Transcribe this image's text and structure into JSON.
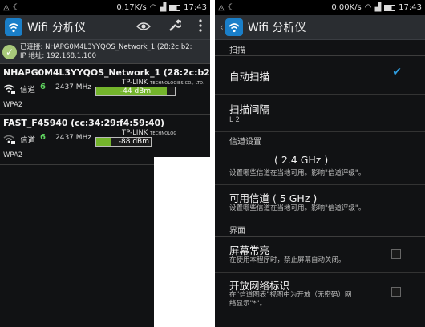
{
  "left": {
    "status": {
      "signal": "0.17K/s",
      "time": "17:43"
    },
    "app_title": "Wifi 分析仪",
    "connected": {
      "line1": "已连接: NHAPG0M4L3YYQOS_Network_1 (28:2c:b2:",
      "line2": "IP 地址: 192.168.1.100"
    },
    "networks": [
      {
        "ssid": "NHAPG0M4L3YYQOS_Network_1 (28:2c:b2:c.",
        "channel_label": "信道",
        "channel": "6",
        "freq": "2437 MHz",
        "vendor": "TP-LINK",
        "vendor_sub": "TECHNOLOGIES CO., LTD.",
        "dbm": "-44 dBm",
        "strength": 0.9,
        "security": "WPA2"
      },
      {
        "ssid": "FAST_F45940 (cc:34:29:f4:59:40)",
        "channel_label": "信道",
        "channel": "6",
        "freq": "2437 MHz",
        "vendor": "TP-LINK",
        "vendor_sub": "TECHNOLOG",
        "dbm": "-88 dBm",
        "strength": 0.28,
        "security": "WPA2"
      }
    ]
  },
  "right": {
    "status": {
      "signal": "0.00K/s",
      "time": "17:43"
    },
    "app_title": "Wifi 分析仪",
    "sections": {
      "scan": "扫描",
      "channel": "信道设置",
      "ui": "界面"
    },
    "prefs": {
      "auto_scan": {
        "title": "自动扫描",
        "checked": true
      },
      "scan_interval": {
        "title": "扫描间隔",
        "summary": "L 2"
      },
      "channels_24": {
        "title": "( 2.4 GHz )",
        "summary": "设置哪些信道在当地可用。影响\"信道评级\"。"
      },
      "channels_5": {
        "title": "可用信道 ( 5 GHz )",
        "summary": "设置哪些信道在当地可用。影响\"信道评级\"。"
      },
      "screen_on": {
        "title": "屏幕常亮",
        "summary": "在使用本程序时，禁止屏幕自动关闭。",
        "checked": false
      },
      "open_mark": {
        "title": "开放网络标识",
        "summary1": "在\"信道图表\"视图中为开放（无密码）网",
        "summary2": "络显示\"*\"。",
        "checked": false
      }
    }
  },
  "colors": {
    "accent": "#2e9de0",
    "signal_green": "#74b42c",
    "channel_green": "#5fd35f",
    "check_ok": "#a8c97a"
  }
}
